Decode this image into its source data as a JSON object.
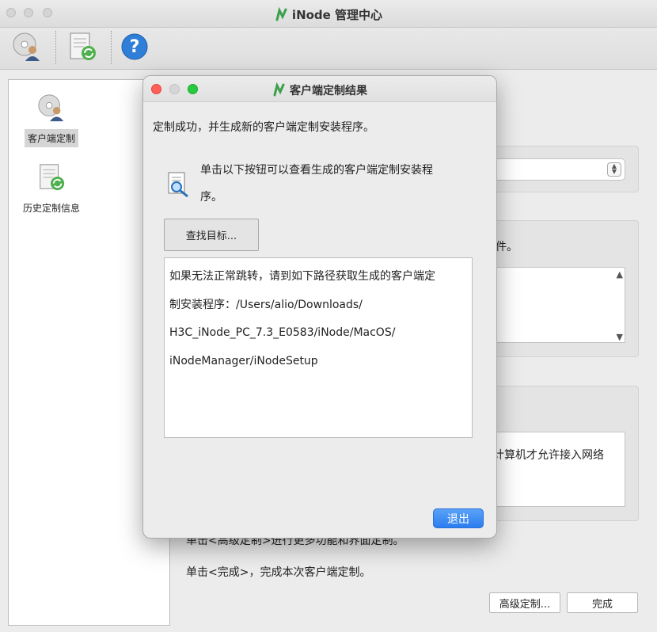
{
  "window": {
    "title": "iNode 管理中心"
  },
  "toolbar": {
    "buttons": [
      "customize-client-icon",
      "history-icon",
      "help-icon"
    ]
  },
  "sidebar": {
    "items": [
      {
        "label": "客户端定制",
        "icon": "disc-user-icon",
        "selected": true
      },
      {
        "label": "历史定制信息",
        "icon": "document-refresh-icon",
        "selected": false
      }
    ]
  },
  "background": {
    "partial_text_1": "件。",
    "partial_text_2": "计算机才允许接入网络",
    "instruction_advanced": "单击<高级定制>进行更多功能和界面定制。",
    "instruction_done": "单击<完成>，完成本次客户端定制。",
    "advanced_button": "高级定制...",
    "done_button": "完成"
  },
  "dialog": {
    "title": "客户端定制结果",
    "message": "定制成功，并生成新的客户端定制安装程序。",
    "hint_line1": "单击以下按钮可以查看生成的客户端定制安装程",
    "hint_line2": "序。",
    "find_button": "查找目标...",
    "path_lines": [
      "如果无法正常跳转，请到如下路径获取生成的客户端定",
      "制安装程序：/Users/alio/Downloads/",
      "H3C_iNode_PC_7.3_E0583/iNode/MacOS/",
      "iNodeManager/iNodeSetup"
    ],
    "exit_button": "退出"
  },
  "colors": {
    "accent": "#2b7df0",
    "close": "#fe5f57",
    "minimize": "#febc2e",
    "zoom": "#28c840"
  }
}
